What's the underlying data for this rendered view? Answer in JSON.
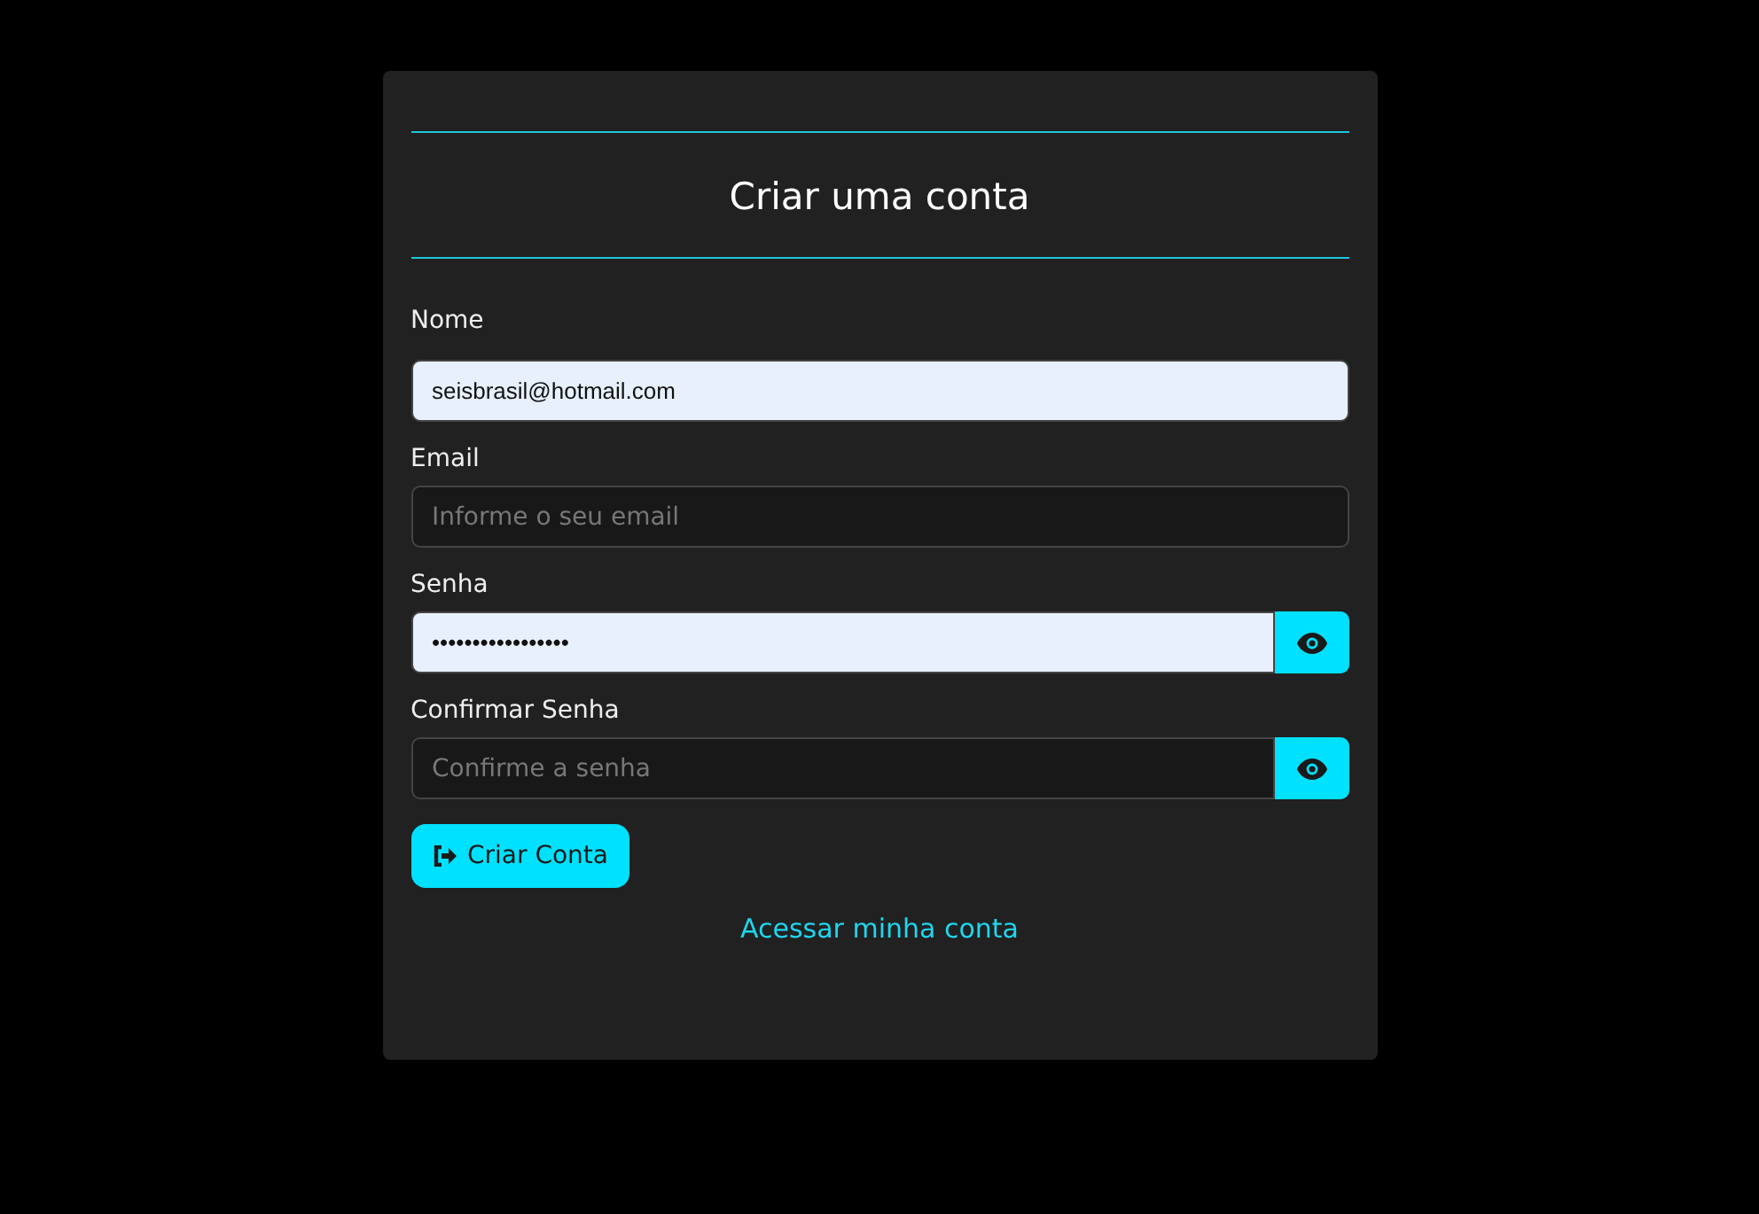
{
  "title": "Criar uma conta",
  "fields": [
    {
      "label": "Nome",
      "kind": "text",
      "value": "seisbrasil@hotmail.com",
      "autofilled": true
    },
    {
      "label": "Email",
      "kind": "text",
      "placeholder": "Informe o seu email",
      "autofilled": false
    },
    {
      "label": "Senha",
      "kind": "password",
      "value": "•••••••••••••••••",
      "autofilled": true
    },
    {
      "label": "Confirmar Senha",
      "kind": "password",
      "placeholder": "Confirme a senha",
      "autofilled": false
    }
  ],
  "submit_button": "Criar Conta",
  "login_link": "Acessar minha conta"
}
